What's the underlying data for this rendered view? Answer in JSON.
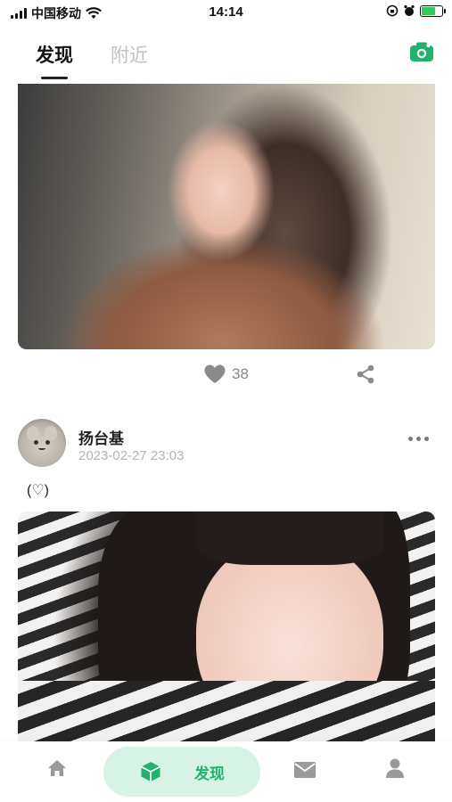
{
  "status_bar": {
    "carrier": "中国移动",
    "time": "14:14",
    "battery_color": "#34c759"
  },
  "header": {
    "tabs": [
      {
        "label": "发现",
        "active": true
      },
      {
        "label": "附近",
        "active": false
      }
    ],
    "camera_icon": "camera-icon",
    "accent_color": "#21b36b"
  },
  "post1": {
    "likes": "38"
  },
  "post2": {
    "username": "扬台基",
    "time": "2023-02-27 23:03",
    "text": "(♡)"
  },
  "bottom_nav": {
    "items": [
      {
        "icon": "home-icon"
      },
      {
        "icon": "discover-cube-icon",
        "label": "发现",
        "active": true
      },
      {
        "icon": "mail-icon"
      },
      {
        "icon": "profile-icon"
      }
    ]
  }
}
